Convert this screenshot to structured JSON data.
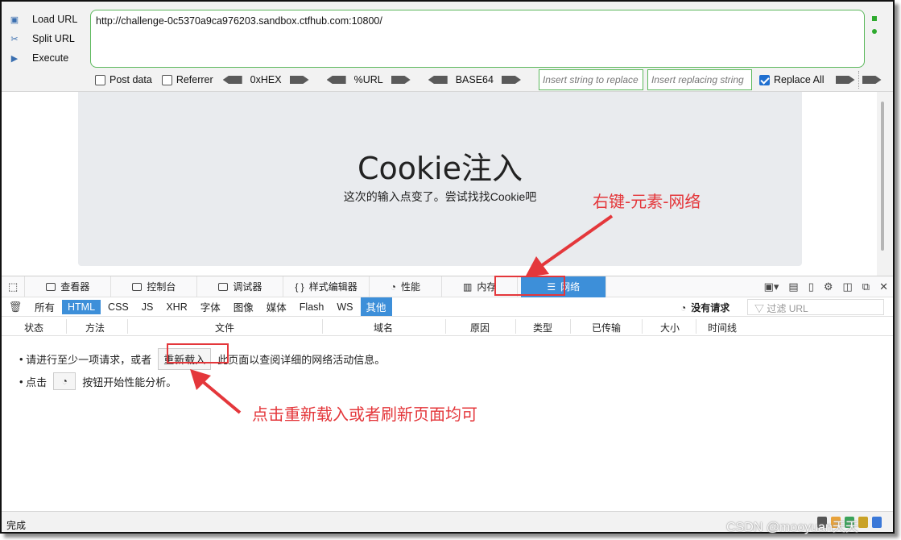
{
  "hackbar": {
    "load_url": "Load URL",
    "split_url": "Split URL",
    "execute": "Execute",
    "url": "http://challenge-0c5370a9ca976203.sandbox.ctfhub.com:10800/",
    "post_data": "Post data",
    "referrer": "Referrer",
    "hex": "0xHEX",
    "urlenc": "%URL",
    "base64": "BASE64",
    "insert_placeholder": "Insert string to replace",
    "replacing_placeholder": "Insert replacing string",
    "replace_all": "Replace All"
  },
  "page": {
    "title": "Cookie注入",
    "subtitle": "这次的输入点变了。尝试找找Cookie吧"
  },
  "devtools": {
    "tabs": [
      "查看器",
      "控制台",
      "调试器",
      "样式编辑器",
      "性能",
      "内存",
      "网络"
    ],
    "filters": [
      "所有",
      "HTML",
      "CSS",
      "JS",
      "XHR",
      "字体",
      "图像",
      "媒体",
      "Flash",
      "WS",
      "其他"
    ],
    "no_requests": "没有请求",
    "filter_url": "过滤 URL",
    "columns": [
      "状态",
      "方法",
      "文件",
      "域名",
      "原因",
      "类型",
      "已传输",
      "大小",
      "时间线"
    ],
    "msg1_before": "请进行至少一项请求，或者",
    "reload_button": "重新载入",
    "msg1_after": "此页面以查阅详细的网络活动信息。",
    "msg2_before": "点击",
    "msg2_after": "按钮开始性能分析。"
  },
  "status": {
    "text": "完成"
  },
  "annotations": {
    "top": "右键-元素-网络",
    "bottom": "点击重新载入或者刷新页面均可",
    "color": "#e4373b"
  },
  "watermark": "CSDN @mooyuan天天"
}
